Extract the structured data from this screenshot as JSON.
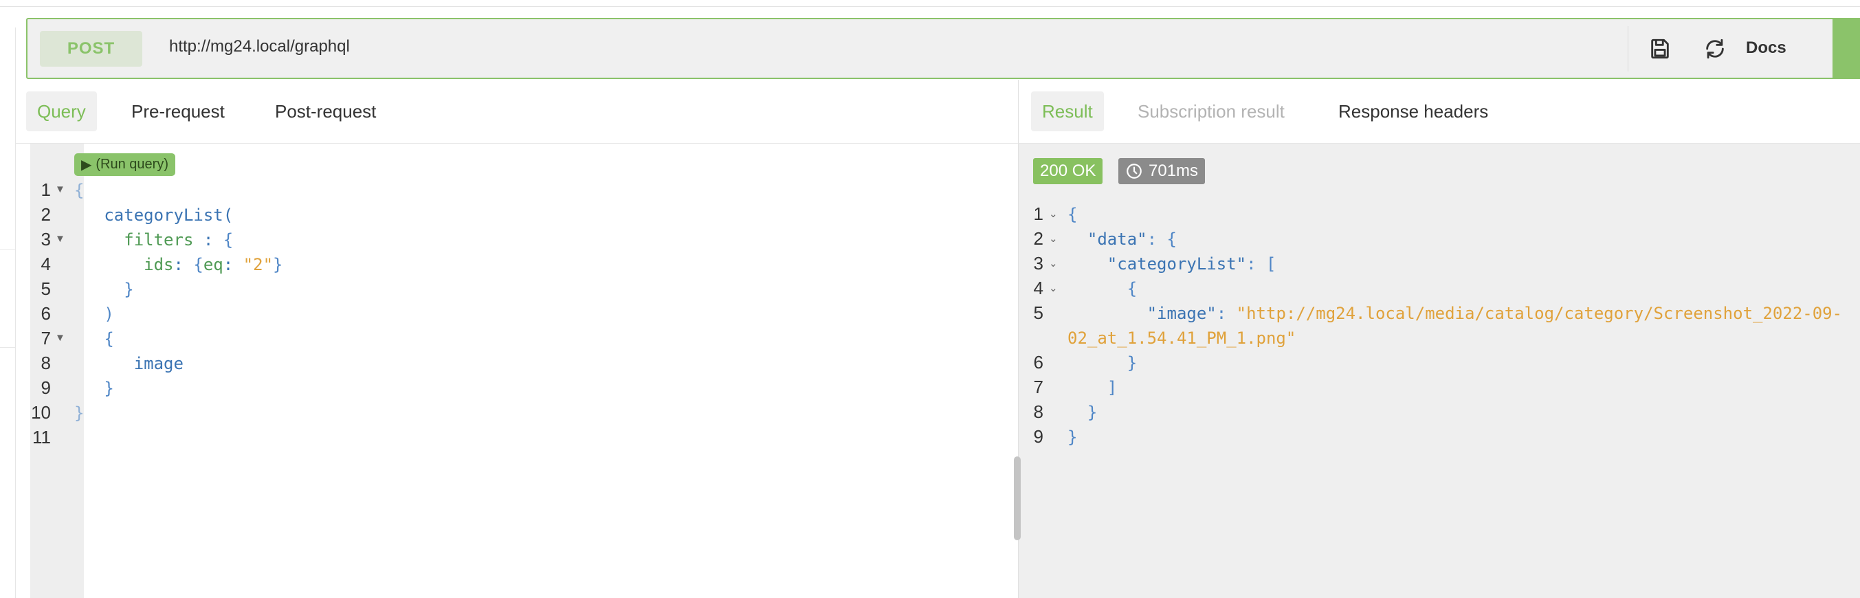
{
  "request": {
    "method": "POST",
    "url": "http://mg24.local/graphql",
    "docs_label": "Docs",
    "save_icon": "save-icon",
    "prettify_icon": "refresh-icon"
  },
  "editor_tabs": [
    "Query",
    "Pre-request",
    "Post-request"
  ],
  "result_tabs": [
    "Result",
    "Subscription result",
    "Response headers"
  ],
  "run_query_label": "(Run query)",
  "query": {
    "line_numbers": [
      "1",
      "2",
      "3",
      "4",
      "5",
      "6",
      "7",
      "8",
      "9",
      "10",
      "11"
    ],
    "lines": [
      [
        {
          "t": "{",
          "c": "c-brace-light"
        }
      ],
      [
        {
          "t": "   categoryList(",
          "c": "c-field"
        }
      ],
      [
        {
          "t": "     filters",
          "c": "c-arg"
        },
        {
          "t": " : ",
          "c": "c-field"
        },
        {
          "t": "{",
          "c": "c-brace"
        }
      ],
      [
        {
          "t": "       ids",
          "c": "c-arg"
        },
        {
          "t": ": ",
          "c": "c-field"
        },
        {
          "t": "{",
          "c": "c-brace"
        },
        {
          "t": "eq",
          "c": "c-arg"
        },
        {
          "t": ": ",
          "c": "c-field"
        },
        {
          "t": "\"2\"",
          "c": "c-str"
        },
        {
          "t": "}",
          "c": "c-brace"
        }
      ],
      [
        {
          "t": "     }",
          "c": "c-brace"
        }
      ],
      [
        {
          "t": "   )",
          "c": "c-brace"
        }
      ],
      [
        {
          "t": "   {",
          "c": "c-brace"
        }
      ],
      [
        {
          "t": "      image",
          "c": "c-field"
        }
      ],
      [
        {
          "t": "   }",
          "c": "c-brace"
        }
      ],
      [
        {
          "t": "}",
          "c": "c-brace-light"
        }
      ],
      []
    ]
  },
  "response": {
    "status": "200 OK",
    "time": "701ms",
    "line_numbers": [
      "1",
      "2",
      "3",
      "4",
      "5",
      "",
      "6",
      "7",
      "8",
      "9"
    ],
    "lines": [
      [
        {
          "t": "{",
          "c": "c-brace"
        }
      ],
      [
        {
          "t": "  \"data\"",
          "c": "c-key"
        },
        {
          "t": ": {",
          "c": "c-brace"
        }
      ],
      [
        {
          "t": "    \"categoryList\"",
          "c": "c-key"
        },
        {
          "t": ": [",
          "c": "c-brace"
        }
      ],
      [
        {
          "t": "      {",
          "c": "c-brace"
        }
      ],
      [
        {
          "t": "        \"image\"",
          "c": "c-key"
        },
        {
          "t": ": ",
          "c": "c-brace"
        },
        {
          "t": "\"http://mg24.local/media/catalog/category/Screenshot_2022-09-",
          "c": "c-str"
        }
      ],
      [
        {
          "t": "02_at_1.54.41_PM_1.png\"",
          "c": "c-str"
        }
      ],
      [
        {
          "t": "      }",
          "c": "c-brace"
        }
      ],
      [
        {
          "t": "    ]",
          "c": "c-brace"
        }
      ],
      [
        {
          "t": "  }",
          "c": "c-brace"
        }
      ],
      [
        {
          "t": "}",
          "c": "c-brace"
        }
      ]
    ]
  },
  "colors": {
    "accent": "#8bc36a",
    "string": "#e0a23b",
    "keyword": "#3b74b3"
  }
}
